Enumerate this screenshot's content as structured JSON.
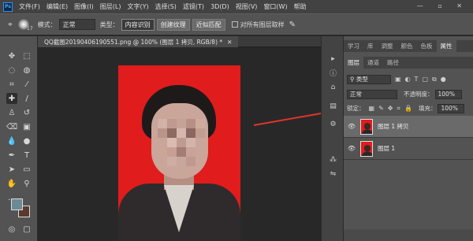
{
  "menubar": {
    "logo": "Ps",
    "items": [
      "文件(F)",
      "编辑(E)",
      "图像(I)",
      "图层(L)",
      "文字(Y)",
      "选择(S)",
      "滤镜(T)",
      "3D(D)",
      "视图(V)",
      "窗口(W)",
      "帮助"
    ],
    "controls": "— ▫ ✕"
  },
  "options": {
    "brush_size": "17",
    "mode_label": "模式：",
    "mode_value": "正常",
    "type_label": "类型：",
    "btn_content_aware": "内容识别",
    "btn_create_texture": "创建纹理",
    "btn_proximity": "近似匹配",
    "sample_all_label": "对所有图层取样"
  },
  "document": {
    "tab_title": "QQ截图20190406190551.png @ 100% (图层 1 拷贝, RGB/8) *",
    "tab_close": "✕"
  },
  "panel": {
    "tabs_top": [
      "学习",
      "库",
      "调整",
      "颜色",
      "色板",
      "属性"
    ],
    "tabs_layers": [
      "图层",
      "通道",
      "路径"
    ],
    "filter_label": "类型",
    "blend_mode": "正常",
    "opacity_label": "不透明度：",
    "opacity_value": "100%",
    "lock_label": "锁定：",
    "fill_label": "填充：",
    "fill_value": "100%",
    "layers": [
      {
        "name": "图层 1 拷贝",
        "selected": true
      },
      {
        "name": "图层 1",
        "selected": false
      }
    ]
  },
  "colors": {
    "background": "#e01c1c",
    "arrow": "#e2342c",
    "foreground_swatch": "#6b8a94",
    "background_swatch": "#5a3a2c"
  }
}
